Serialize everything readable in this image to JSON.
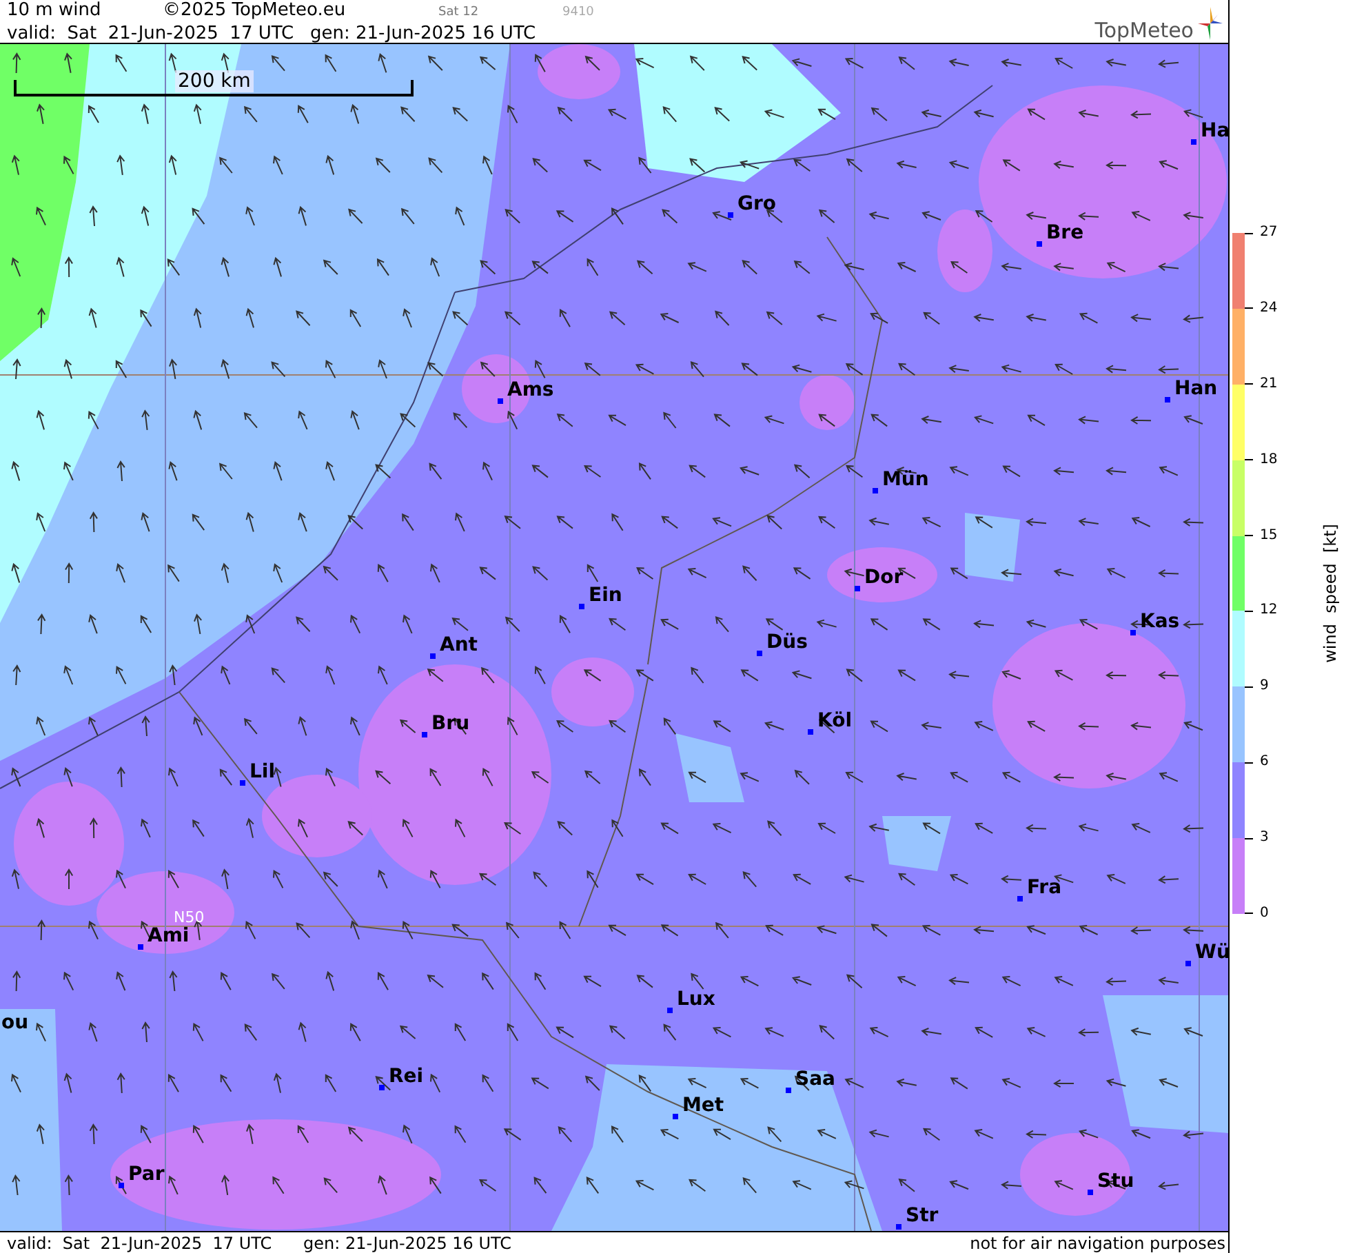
{
  "header": {
    "title": "10 m wind",
    "copyright": "©2025 TopMeteo.eu",
    "run": "Sat 12",
    "code": "9410",
    "valid": "valid:  Sat  21-Jun-2025  17 UTC",
    "generated": "gen: 21-Jun-2025 16 UTC",
    "logo": "TopMeteo"
  },
  "map": {
    "scale": "200 km",
    "grid_label": "N50",
    "cities": [
      "Ha",
      "Gro",
      "Bre",
      "Ams",
      "Han",
      "Mün",
      "Dor",
      "Ein",
      "Kas",
      "Düs",
      "Ant",
      "Köl",
      "Bru",
      "Lil",
      "Fra",
      "Ami",
      "Wü",
      "Lux",
      "ou",
      "Rei",
      "Saa",
      "Met",
      "Par",
      "Stu",
      "Str"
    ]
  },
  "legend": {
    "title": "wind  speed  [kt]",
    "ticks": [
      "27",
      "24",
      "21",
      "18",
      "15",
      "12",
      "9",
      "6",
      "3",
      "0"
    ],
    "bands": [
      {
        "color": "#f08070"
      },
      {
        "color": "#ffb066"
      },
      {
        "color": "#ffff66"
      },
      {
        "color": "#c8ff66"
      },
      {
        "color": "#70ff66"
      },
      {
        "color": "#b0fcff"
      },
      {
        "color": "#98c4ff"
      },
      {
        "color": "#8f84ff"
      },
      {
        "color": "#c77ff8"
      }
    ]
  },
  "footer": {
    "valid": "valid:  Sat  21-Jun-2025  17 UTC",
    "generated": "gen: 21-Jun-2025 16 UTC",
    "notice": "not for air navigation purposes"
  }
}
